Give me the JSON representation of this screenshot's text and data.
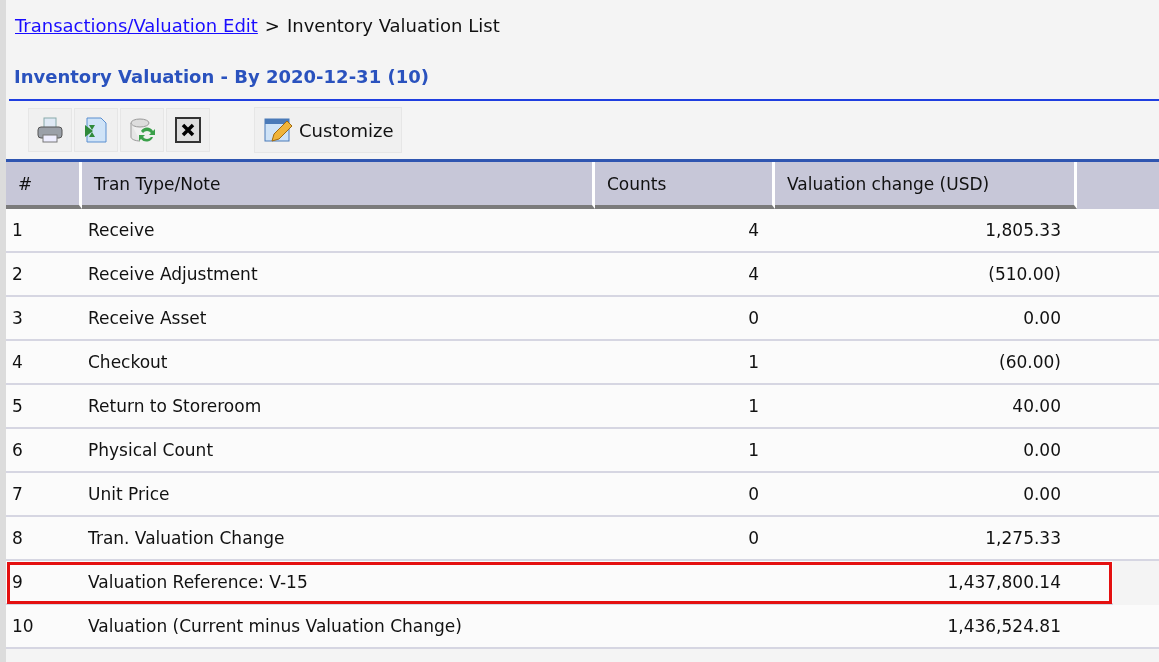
{
  "breadcrumb": {
    "link": "Transactions/Valuation Edit",
    "separator": ">",
    "current": "Inventory Valuation List"
  },
  "title": "Inventory Valuation - By 2020-12-31 (10)",
  "toolbar": {
    "customize_label": "Customize"
  },
  "table": {
    "columns": [
      "#",
      "Tran Type/Note",
      "Counts",
      "Valuation change (USD)"
    ],
    "rows": [
      {
        "cells": [
          "1",
          "Receive",
          "4",
          "1,805.33"
        ],
        "highlighted": false
      },
      {
        "cells": [
          "2",
          "Receive Adjustment",
          "4",
          "(510.00)"
        ],
        "highlighted": false
      },
      {
        "cells": [
          "3",
          "Receive Asset",
          "0",
          "0.00"
        ],
        "highlighted": false
      },
      {
        "cells": [
          "4",
          "Checkout",
          "1",
          "(60.00)"
        ],
        "highlighted": false
      },
      {
        "cells": [
          "5",
          "Return to Storeroom",
          "1",
          "40.00"
        ],
        "highlighted": false
      },
      {
        "cells": [
          "6",
          "Physical Count",
          "1",
          "0.00"
        ],
        "highlighted": false
      },
      {
        "cells": [
          "7",
          "Unit Price",
          "0",
          "0.00"
        ],
        "highlighted": false
      },
      {
        "cells": [
          "8",
          "Tran. Valuation Change",
          "0",
          "1,275.33"
        ],
        "highlighted": false
      },
      {
        "cells": [
          "9",
          "Valuation Reference: V-15",
          "",
          "1,437,800.14"
        ],
        "highlighted": true
      },
      {
        "cells": [
          "10",
          "Valuation (Current minus Valuation Change)",
          "",
          "1,436,524.81"
        ],
        "highlighted": false
      }
    ]
  }
}
